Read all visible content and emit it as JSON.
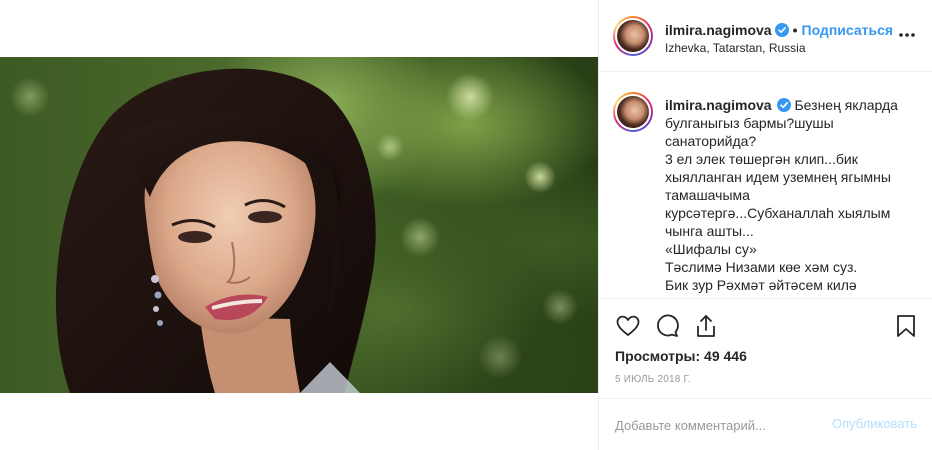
{
  "post": {
    "username": "ilmira.nagimova",
    "verified": true,
    "follow_label": "Подписаться",
    "location": "Izhevka, Tatarstan, Russia",
    "caption": {
      "username": "ilmira.nagimova",
      "lines": [
        "Безнең якларда",
        "булганыгыз бармы?шушы",
        "санаторийда?",
        "3 ел элек төшергән клип...бик",
        "хыялланган идем уземнең ягымны",
        "тамашачыма",
        "курсәтергә...Субханаллаh хыялым",
        "чынга ашты...",
        "«Шифалы су»",
        "Тәслимә Низами көе хәм суз.",
        "Бик зур Рәхмәт әйтәсем килә"
      ]
    },
    "views_label": "Просмотры: 49 446",
    "date": "5 июль 2018 г.",
    "comment_placeholder": "Добавьте комментарий...",
    "publish_label": "Опубликовать"
  },
  "colors": {
    "accent": "#3897f0",
    "publish_disabled": "#b2dffc",
    "muted": "#999999",
    "border": "#efefef"
  },
  "icons": {
    "like": "heart-icon",
    "comment": "comment-icon",
    "share": "share-icon",
    "save": "bookmark-icon",
    "more": "more-options-icon",
    "verified": "verified-badge-icon"
  }
}
